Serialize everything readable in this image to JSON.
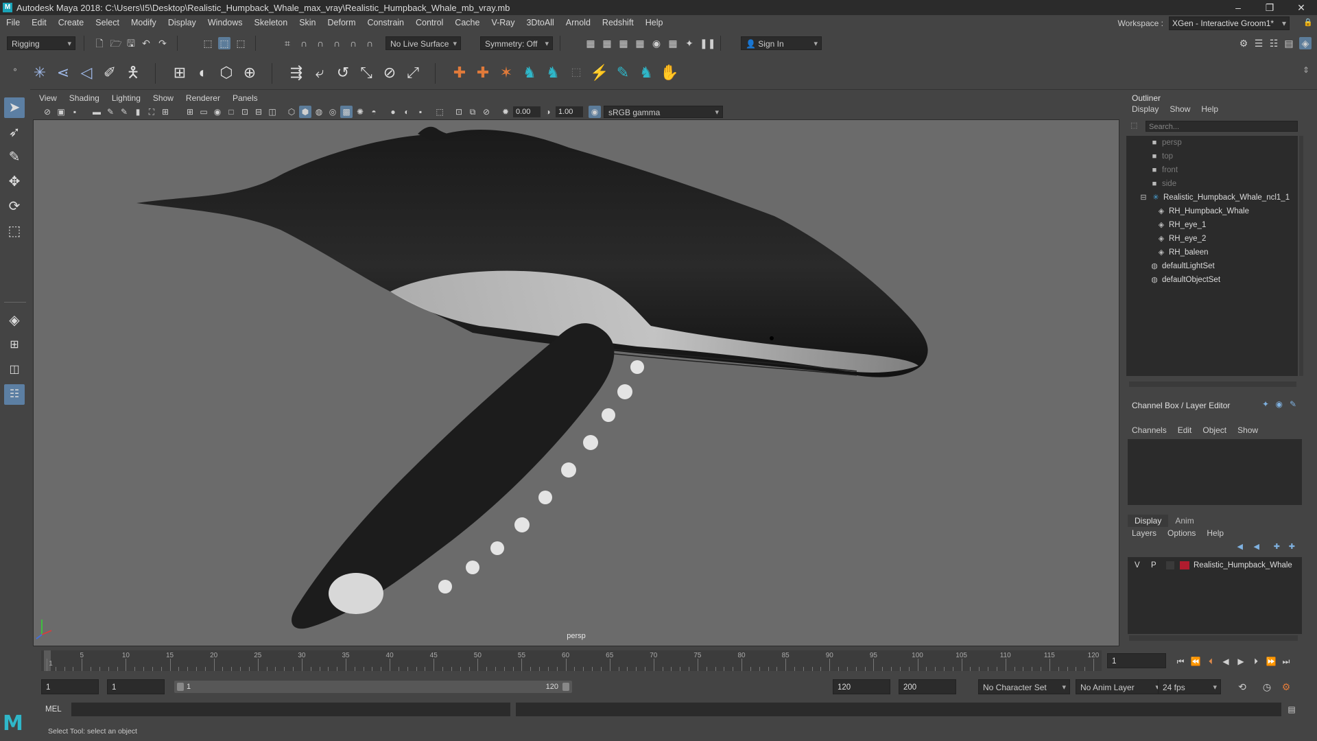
{
  "window": {
    "title": "Autodesk Maya 2018: C:\\Users\\I5\\Desktop\\Realistic_Humpback_Whale_max_vray\\Realistic_Humpback_Whale_mb_vray.mb",
    "logo": "M"
  },
  "menubar": [
    "File",
    "Edit",
    "Create",
    "Select",
    "Modify",
    "Display",
    "Windows",
    "Skeleton",
    "Skin",
    "Deform",
    "Constrain",
    "Control",
    "Cache",
    "V-Ray",
    "3DtoAll",
    "Arnold",
    "Redshift",
    "Help"
  ],
  "workspace": {
    "label": "Workspace :",
    "value": "XGen - Interactive Groom1*"
  },
  "statusline": {
    "mode": "Rigging",
    "live_surface": "No Live Surface",
    "symmetry": "Symmetry: Off",
    "sign_in": "Sign In"
  },
  "viewport": {
    "menu": [
      "View",
      "Shading",
      "Lighting",
      "Show",
      "Renderer",
      "Panels"
    ],
    "exposure": "0.00",
    "gamma": "1.00",
    "color_space": "sRGB gamma",
    "camera": "persp"
  },
  "outliner": {
    "title": "Outliner",
    "menu": [
      "Display",
      "Show",
      "Help"
    ],
    "search_placeholder": "Search...",
    "items": [
      {
        "label": "persp",
        "icon": "camera-icon",
        "dim": true
      },
      {
        "label": "top",
        "icon": "camera-icon",
        "dim": true
      },
      {
        "label": "front",
        "icon": "camera-icon",
        "dim": true
      },
      {
        "label": "side",
        "icon": "camera-icon",
        "dim": true
      },
      {
        "label": "Realistic_Humpback_Whale_ncl1_1",
        "icon": "group-icon",
        "dim": false
      },
      {
        "label": "RH_Humpback_Whale",
        "icon": "mesh-icon",
        "dim": false
      },
      {
        "label": "RH_eye_1",
        "icon": "mesh-icon",
        "dim": false
      },
      {
        "label": "RH_eye_2",
        "icon": "mesh-icon",
        "dim": false
      },
      {
        "label": "RH_baleen",
        "icon": "mesh-icon",
        "dim": false
      },
      {
        "label": "defaultLightSet",
        "icon": "set-icon",
        "dim": false
      },
      {
        "label": "defaultObjectSet",
        "icon": "set-icon",
        "dim": false
      }
    ]
  },
  "channelbox": {
    "title": "Channel Box / Layer Editor",
    "menu": [
      "Channels",
      "Edit",
      "Object",
      "Show"
    ],
    "tabs": [
      "Display",
      "Anim"
    ],
    "layer_menu": [
      "Layers",
      "Options",
      "Help"
    ],
    "layer": {
      "v": "V",
      "p": "P",
      "name": "Realistic_Humpback_Whale",
      "color": "#b01c2e"
    }
  },
  "timeline": {
    "ticks": [
      "1",
      "5",
      "10",
      "15",
      "20",
      "25",
      "30",
      "35",
      "40",
      "45",
      "50",
      "55",
      "60",
      "65",
      "70",
      "75",
      "80",
      "85",
      "90",
      "95",
      "100",
      "105",
      "110",
      "115",
      "120"
    ],
    "current_frame": "1"
  },
  "range": {
    "start": "1",
    "playback_start": "1",
    "slider_start": "1",
    "slider_end": "120",
    "playback_end": "120",
    "end": "200",
    "character_set": "No Character Set",
    "anim_layer": "No Anim Layer",
    "fps": "24 fps"
  },
  "cmdline": {
    "label": "MEL"
  },
  "helpline": {
    "text": "Select Tool: select an object"
  }
}
